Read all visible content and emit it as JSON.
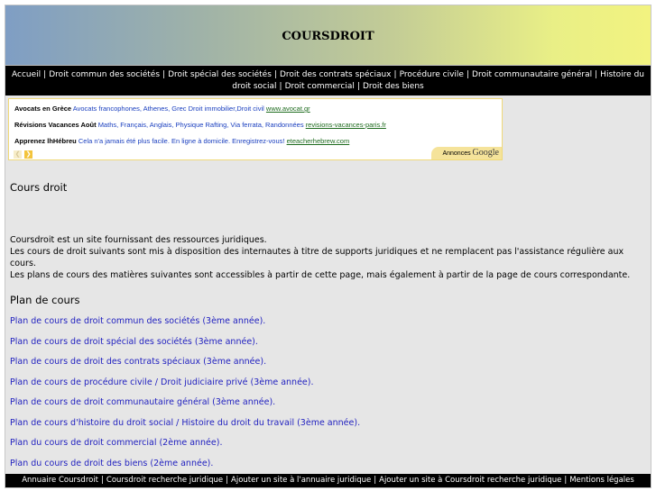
{
  "site": {
    "title": "COURSDROIT"
  },
  "nav": {
    "items": [
      "Accueil",
      "Droit commun des sociétés",
      "Droit spécial des sociétés",
      "Droit des contrats spéciaux",
      "Procédure civile",
      "Droit communautaire général",
      "Histoire du droit social",
      "Droit commercial",
      "Droit des biens"
    ],
    "separator": "|"
  },
  "ads": {
    "items": [
      {
        "title": "Avocats en Grèce",
        "text": "Avocats francophones, Athenes, Grec Droit immobilier,Droit civil",
        "url": "www.avocat.gr"
      },
      {
        "title": "Révisions Vacances Août",
        "text": "Maths, Français, Anglais, Physique Rafting, Via ferrata, Randonnées",
        "url": "revisions-vacances-paris.fr"
      },
      {
        "title": "Apprenez lhHébreu",
        "text": "Cela n'a jamais été plus facile. En ligne à domicile. Enregistrez-vous!",
        "url": "eteacherhebrew.com"
      }
    ],
    "badge_label": "Annonces",
    "badge_brand": "Google",
    "prev_icon": "chevron-left-icon",
    "next_icon": "chevron-right-icon"
  },
  "main": {
    "title": "Cours droit",
    "intro": [
      "Coursdroit est un site fournissant des ressources juridiques.",
      "Les cours de droit suivants sont mis à disposition des internautes à titre de supports juridiques et ne remplacent pas l'assistance régulière aux cours.",
      "Les plans de cours des matières suivantes sont accessibles à partir de cette page, mais également à partir de la page de cours correspondante."
    ],
    "plan_heading": "Plan de cours",
    "courses": [
      "Plan de cours de droit commun des sociétés (3ème année).",
      "Plan de cours de droit spécial des sociétés (3ème année).",
      "Plan de cours de droit des contrats spéciaux (3ème année).",
      "Plan de cours de procédure civile / Droit judiciaire privé (3ème année).",
      "Plan de cours de droit communautaire général (3ème année).",
      "Plan de cours d'histoire du droit social / Histoire du droit du travail (3ème année).",
      "Plan du cours de droit commercial (2ème année).",
      "Plan du cours de droit des biens (2ème année)."
    ]
  },
  "footer": {
    "items": [
      "Annuaire Coursdroit",
      "Coursdroit recherche juridique",
      "Ajouter un site à l'annuaire juridique",
      "Ajouter un site à Coursdroit recherche juridique",
      "Mentions légales"
    ]
  },
  "colors": {
    "link": "#1f1fbf",
    "nav_bg": "#000000",
    "content_bg": "#e6e6e6",
    "ad_url": "#1e6b1e",
    "ad_text": "#1a3fbf"
  }
}
